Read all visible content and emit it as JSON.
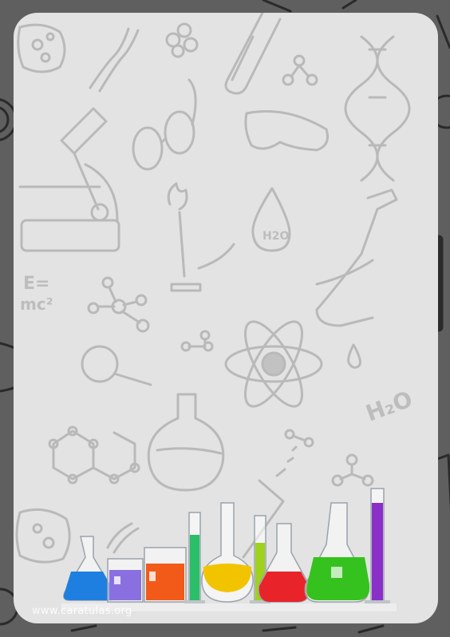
{
  "watermark": "www.caratulas.org",
  "doodle_formula_energy": "E=\nmc²",
  "doodle_formula_water_1": "H₂O",
  "doodle_formula_water_2": "H₂O",
  "colors": {
    "frame": "#5f5f5f",
    "panel": "#e3e3e3",
    "doodle": "#b9b9b9",
    "flask_blue": "#1e7fe0",
    "beaker_purple": "#8a6fe0",
    "beaker_orange": "#f25a1a",
    "cylinder_green": "#2bbf6a",
    "flask_yellow": "#f2c400",
    "cylinder_lime": "#9ed21c",
    "flask_red": "#e8242a",
    "flask_green": "#36c21e",
    "cylinder_violet": "#8a2fc8"
  }
}
